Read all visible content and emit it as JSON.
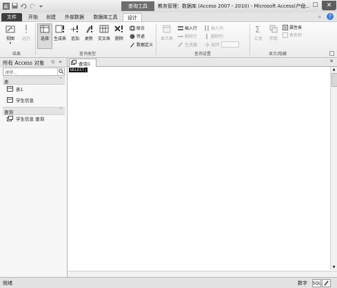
{
  "titlebar": {
    "context_tab": "查询工具",
    "title": "教务管理：数据库 (Access 2007 - 2010) - Microsoft Access(产品...",
    "minimize": "—",
    "maximize": "☐",
    "close": "✕"
  },
  "tabs": {
    "file": "文件",
    "home": "开始",
    "create": "创建",
    "external": "外部数据",
    "dbtools": "数据库工具",
    "design": "设计"
  },
  "ribbon": {
    "results": {
      "label": "结果",
      "view": "视图",
      "run": "运行"
    },
    "query_type": {
      "label": "查询类型",
      "select": "选择",
      "make_table": "生成表",
      "append": "追加",
      "update": "更新",
      "crosstab": "交叉表",
      "delete": "删除",
      "union": "联合",
      "pass_through": "传递",
      "data_definition": "数据定义"
    },
    "query_setup": {
      "label": "查询设置",
      "show_table": "显示表",
      "insert_rows": "插入行",
      "delete_rows": "删除行",
      "builder": "生成器",
      "insert_columns": "插入列",
      "delete_columns": "删除列",
      "return": "返回"
    },
    "show_hide": {
      "label": "显示/隐藏",
      "totals": "汇总",
      "parameters": "参数",
      "property_sheet": "属性表",
      "table_names": "表名称"
    }
  },
  "nav": {
    "title": "所有 Access 对象",
    "search_placeholder": "搜索...",
    "sections": [
      {
        "label": "表",
        "items": [
          "表1",
          "学生信息"
        ]
      },
      {
        "label": "查询",
        "items": [
          "学生信息 查询"
        ]
      }
    ]
  },
  "document": {
    "tab_label": "查询1",
    "sql_text": "SELECT;"
  },
  "status": {
    "left": "就绪",
    "numlock": "数字"
  },
  "colors": {
    "file_tab": "#3e3e3e",
    "context_tab": "#6d6d6d"
  }
}
